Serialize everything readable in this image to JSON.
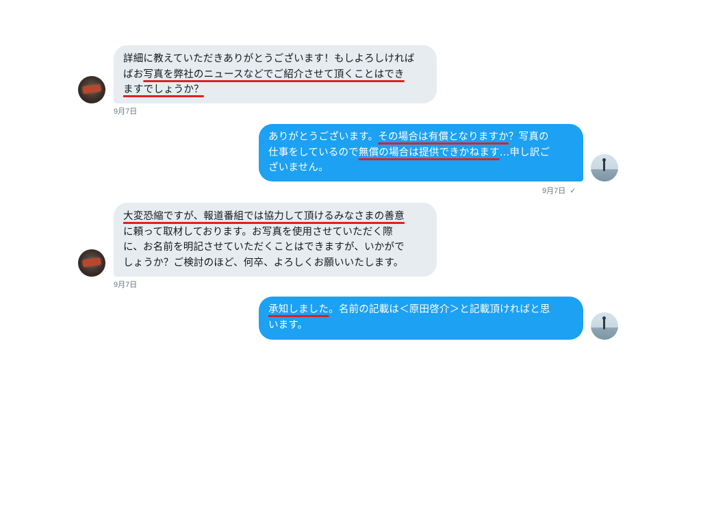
{
  "conversation": {
    "messages": [
      {
        "direction": "received",
        "lines": [
          [
            {
              "t": "詳細に教えていただきありがとうございます！もしよろしければ"
            }
          ],
          [
            {
              "t": "ばお"
            },
            {
              "t": "写真を弊社のニュースなどでご紹介させて頂くことはでき",
              "hl": true
            }
          ],
          [
            {
              "t": "ますでしょうか？",
              "hl": true
            }
          ]
        ],
        "timestamp": "9月7日"
      },
      {
        "direction": "sent",
        "lines": [
          [
            {
              "t": "ありがとうございます。"
            },
            {
              "t": "その場合は有償となりますか",
              "hl": true
            },
            {
              "t": "？写真の"
            }
          ],
          [
            {
              "t": "仕事をしているので"
            },
            {
              "t": "無償の場合は提供できかねます",
              "hl": true
            },
            {
              "t": "…申し訳ご"
            }
          ],
          [
            {
              "t": "ざいません。"
            }
          ]
        ],
        "timestamp": "9月7日",
        "status_icon": "✓"
      },
      {
        "direction": "received",
        "lines": [
          [
            {
              "t": "大変恐縮ですが、報道番組では協力して頂けるみなさまの善意",
              "hl": true
            }
          ],
          [
            {
              "t": "に頼って取材しております。お写真を使用させていただく際"
            }
          ],
          [
            {
              "t": "に、お名前を明記させていただくことはできますが、いかがで"
            }
          ],
          [
            {
              "t": "しょうか？ご検討のほど、何卒、よろしくお願いいたします。"
            }
          ]
        ],
        "timestamp": "9月7日"
      },
      {
        "direction": "sent",
        "lines": [
          [
            {
              "t": "承知しました",
              "hl": true
            },
            {
              "t": "。名前の記載は＜原田啓介＞と記載頂ければと思"
            }
          ],
          [
            {
              "t": "います。"
            }
          ]
        ]
      }
    ]
  },
  "colors": {
    "sent_bubble": "#1da1f2",
    "received_bubble": "#e6ecf0",
    "highlight_underline": "#e02020",
    "timestamp_text": "#657786"
  },
  "icons": {
    "sender_avatar": "news-media-avatar",
    "user_avatar": "seaside-person-avatar",
    "read_status": "check-icon"
  }
}
